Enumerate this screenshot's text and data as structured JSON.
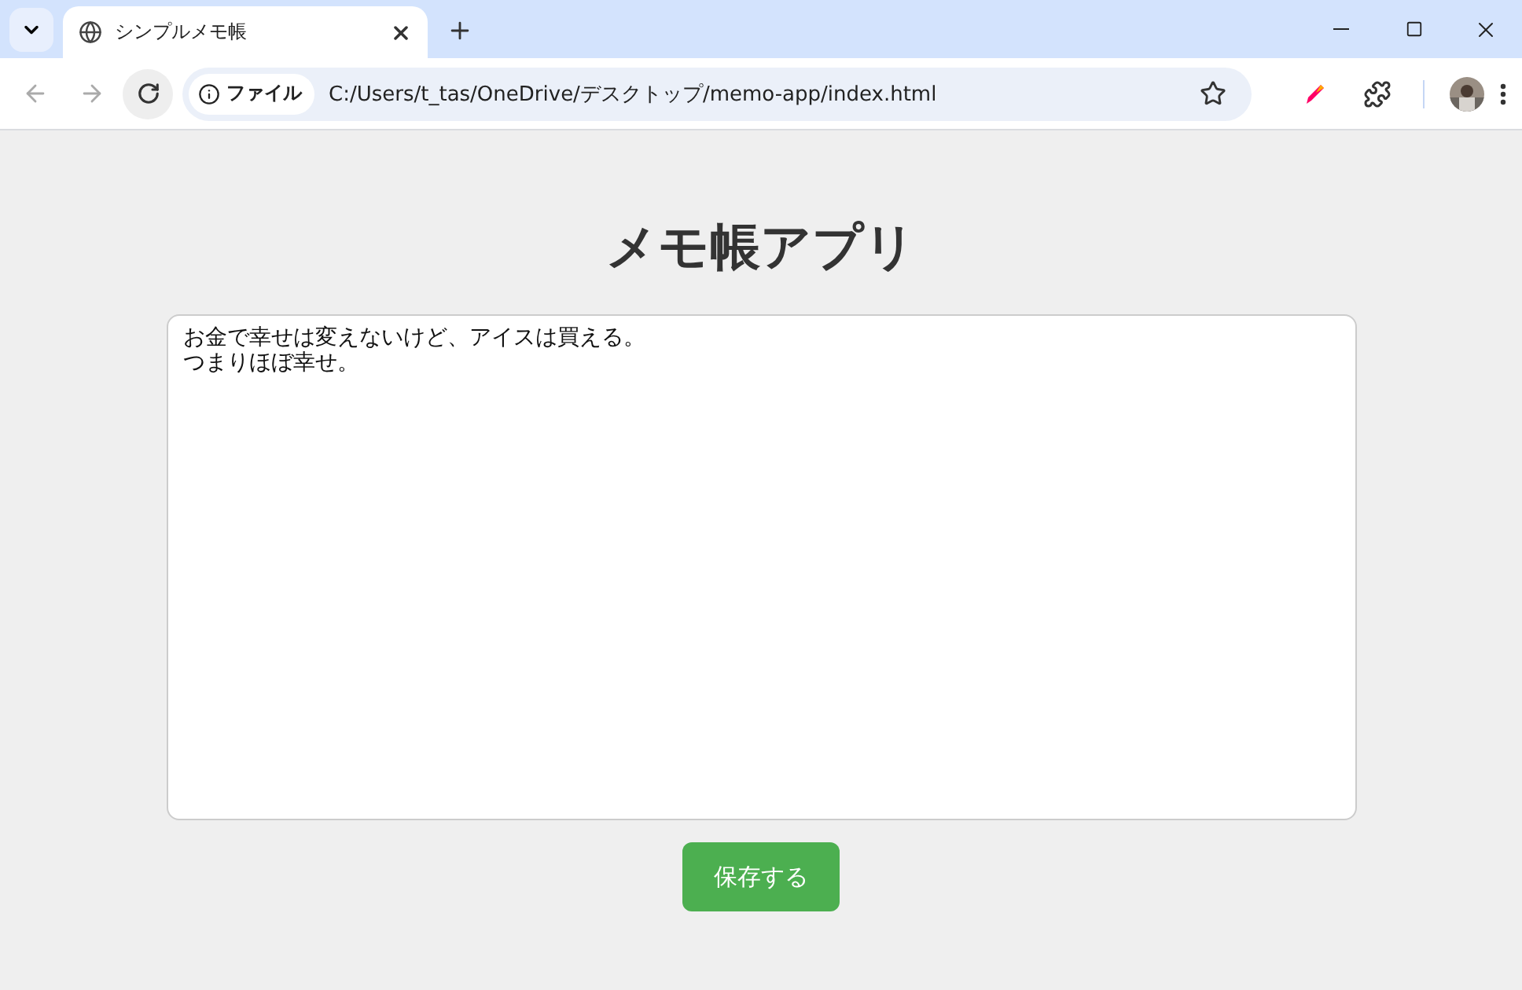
{
  "browser": {
    "tab": {
      "title": "シンプルメモ帳",
      "selected": true
    },
    "address": {
      "badge": "ファイル",
      "url": "C:/Users/t_tas/OneDrive/デスクトップ/memo-app/index.html"
    }
  },
  "page": {
    "heading": "メモ帳アプリ",
    "memo_lines": [
      "お金で幸せは変えないけど、アイスは買える。",
      "つまりほぼ幸せ。"
    ],
    "save_button": "保存する"
  }
}
